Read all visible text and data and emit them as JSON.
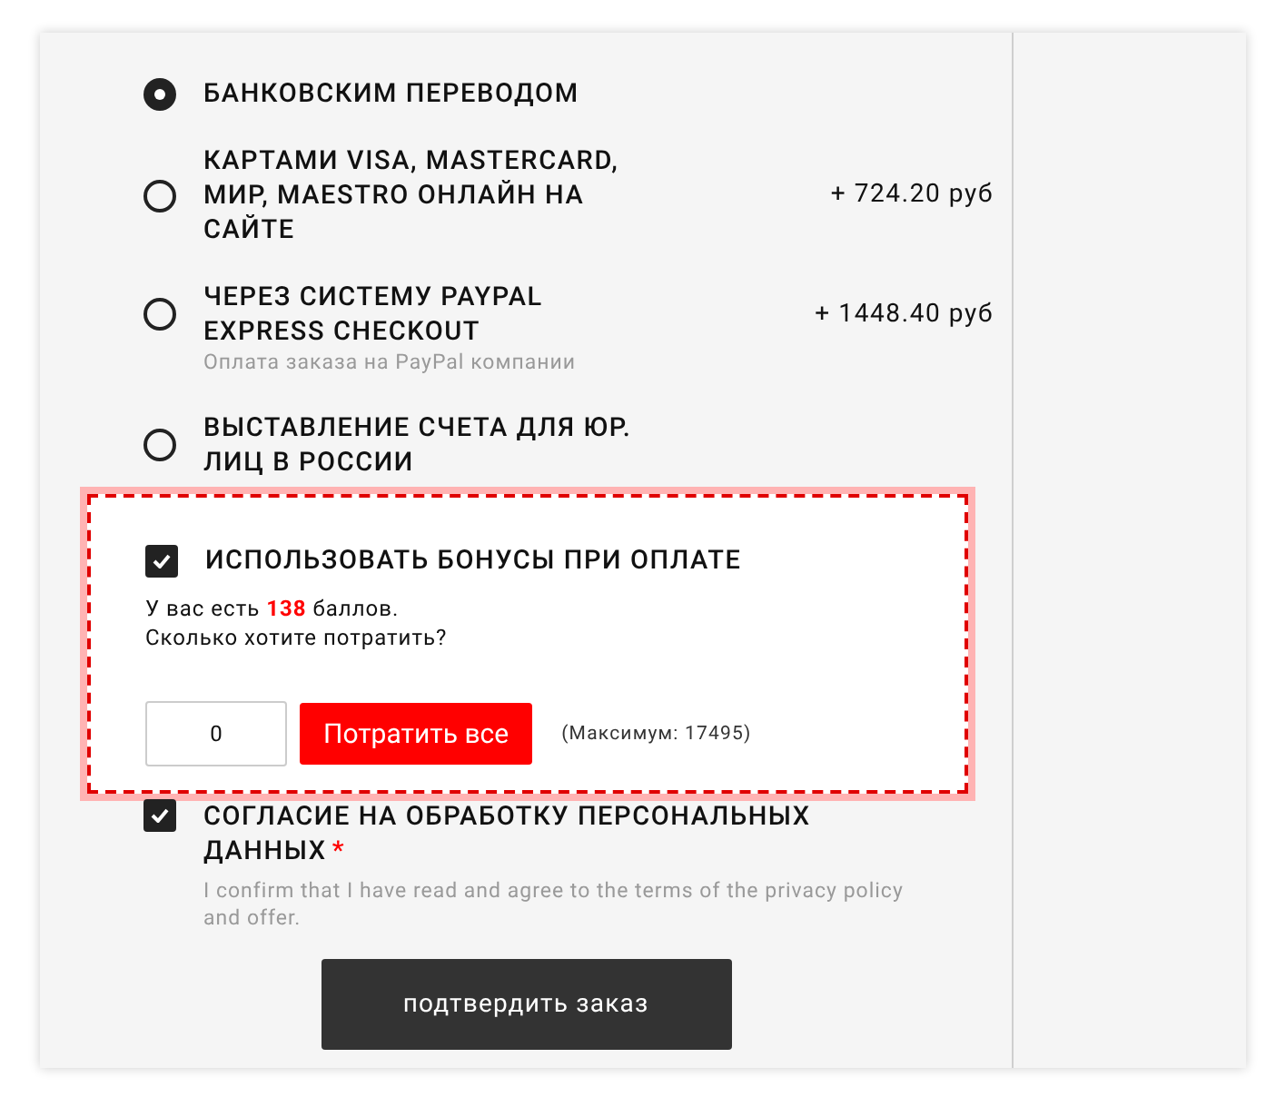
{
  "payment_methods": [
    {
      "label": "БАНКОВСКИМ ПЕРЕВОДОМ",
      "selected": true
    },
    {
      "label": "КАРТАМИ VISA, MASTERCARD, МИР, MAESTRO ОНЛАЙН НА САЙТЕ",
      "price": "+ 724.20 руб",
      "selected": false
    },
    {
      "label": "ЧЕРЕЗ СИСТЕМУ PAYPAL EXPRESS CHECKOUT",
      "price": "+ 1448.40 руб",
      "note": "Оплата заказа на PayPal компании",
      "selected": false
    },
    {
      "label": "ВЫСТАВЛЕНИЕ СЧЕТА ДЛЯ ЮР. ЛИЦ В РОССИИ",
      "selected": false
    }
  ],
  "bonus": {
    "label": "ИСПОЛЬЗОВАТЬ БОНУСЫ ПРИ ОПЛАТЕ",
    "checked": true,
    "balance_before": "У вас есть",
    "balance": "138",
    "balance_after": "баллов.",
    "question": "Сколько хотите потратить?",
    "amount": "0",
    "spend_all_button": "Потратить все",
    "maximum": "(Максимум: 17495)"
  },
  "consent": {
    "label": "СОГЛАСИЕ НА ОБРАБОТКУ ПЕРСОНАЛЬНЫХ ДАННЫХ",
    "required_mark": "*",
    "checked": true,
    "note": "I confirm that I have read and agree to the terms of the privacy policy and offer."
  },
  "confirm_button": "подтвердить заказ"
}
